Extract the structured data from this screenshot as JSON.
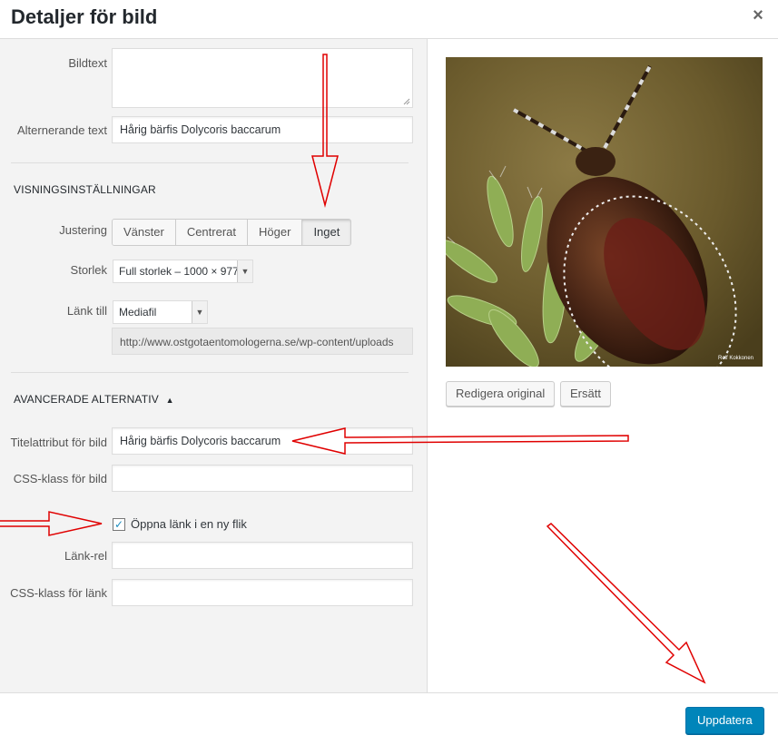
{
  "dialog": {
    "title": "Detaljer för bild",
    "close_symbol": "×"
  },
  "fields": {
    "caption_label": "Bildtext",
    "caption_value": "",
    "alt_label": "Alternerande text",
    "alt_value": "Hårig bärfis Dolycoris baccarum"
  },
  "display": {
    "heading": "Visningsinställningar",
    "align_label": "Justering",
    "align_options": [
      "Vänster",
      "Centrerat",
      "Höger",
      "Inget"
    ],
    "align_selected": "Inget",
    "size_label": "Storlek",
    "size_value": "Full storlek – 1000 × 977",
    "link_label": "Länk till",
    "link_value": "Mediafil",
    "link_url": "http://www.ostgotaentomologerna.se/wp-content/uploads"
  },
  "advanced": {
    "heading": "Avancerade alternativ",
    "toggle_symbol": "▲",
    "title_attr_label": "Titelattribut för bild",
    "title_attr_value": "Hårig bärfis Dolycoris baccarum",
    "css_image_label": "CSS-klass för bild",
    "css_image_value": "",
    "new_tab_label": "Öppna länk i en ny flik",
    "new_tab_checked": true,
    "link_rel_label": "Länk-rel",
    "link_rel_value": "",
    "css_link_label": "CSS-klass för länk",
    "css_link_value": ""
  },
  "image_panel": {
    "edit_original": "Redigera original",
    "replace": "Ersätt",
    "watermark": "Rolf Kokkonen"
  },
  "footer": {
    "update_button": "Uppdatera"
  },
  "colors": {
    "primary": "#0085ba",
    "annotation_red": "#e00000"
  },
  "icons": {
    "close": "close-icon",
    "checkbox": "checkbox-checked-icon",
    "triangle": "triangle-up-icon",
    "dropdown": "chevron-down-icon"
  }
}
